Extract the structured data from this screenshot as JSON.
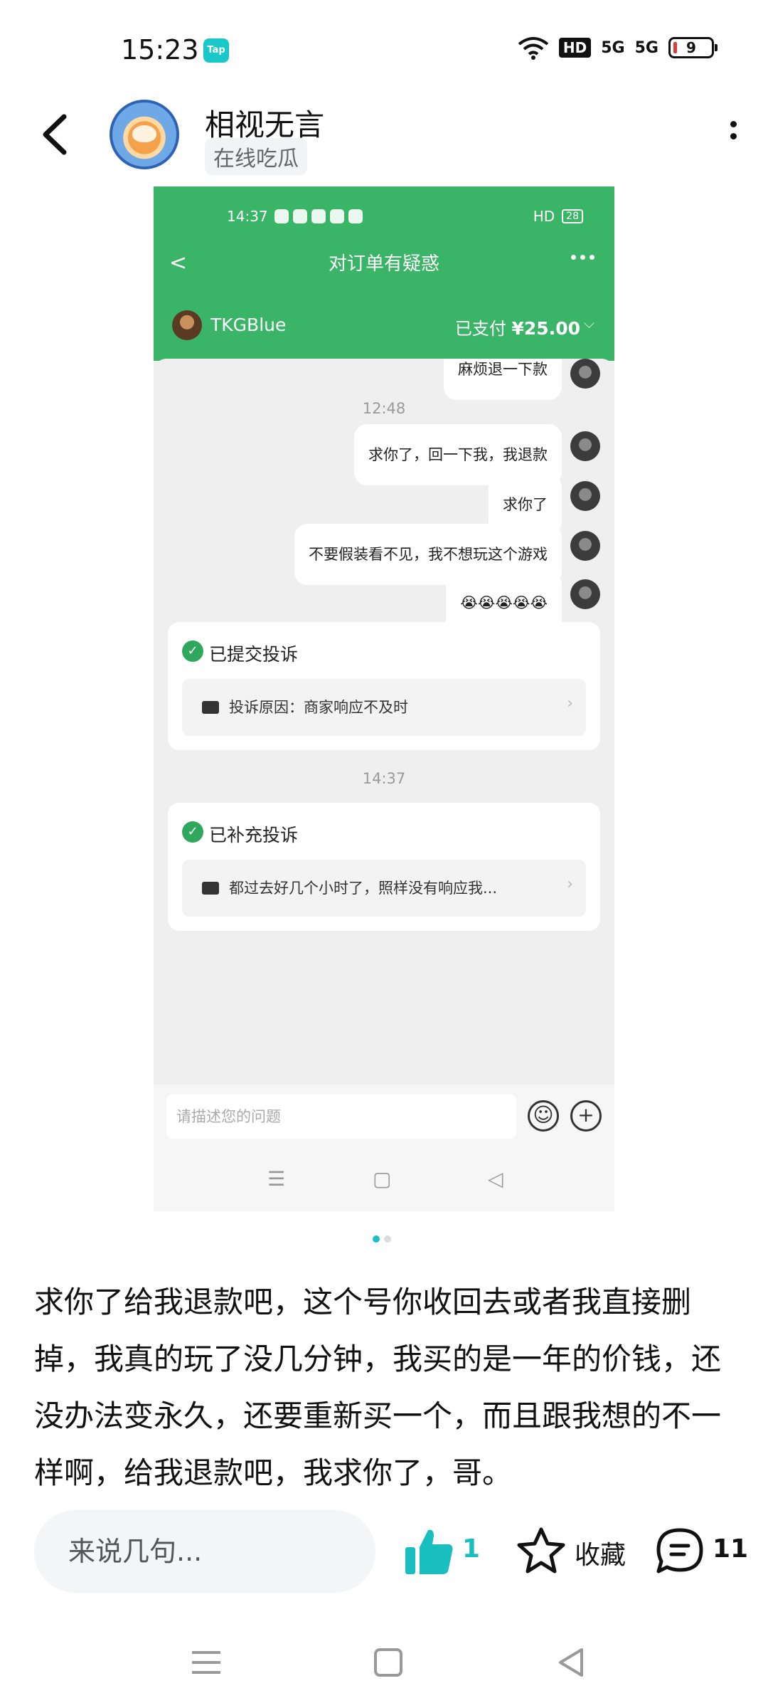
{
  "status_bar": {
    "time": "15:23",
    "app_badge": "Tap",
    "hd": "HD",
    "signal_1": "5G",
    "signal_2": "5G",
    "battery": "9"
  },
  "header": {
    "username": "相视无言",
    "tag": "在线吃瓜"
  },
  "screenshot": {
    "status_time": "14:37",
    "status_hd": "HD",
    "battery": "28",
    "title": "对订单有疑惑",
    "seller": "TKGBlue",
    "paid_label": "已支付",
    "paid_amount": "¥25.00",
    "messages": [
      {
        "text": "麻烦退一下款"
      },
      {
        "text": "求你了，回一下我，我退款"
      },
      {
        "text": "求你了"
      },
      {
        "text": "不要假装看不见，我不想玩这个游戏"
      },
      {
        "text": "😭😭😭😭😭"
      }
    ],
    "timestamps": [
      "12:48",
      "14:37"
    ],
    "cards": [
      {
        "title": "已提交投诉",
        "detail": "投诉原因：商家响应不及时"
      },
      {
        "title": "已补充投诉",
        "detail": "都过去好几个小时了，照样没有响应我..."
      }
    ],
    "input_placeholder": "请描述您的问题"
  },
  "post": {
    "text": "求你了给我退款吧，这个号你收回去或者我直接删掉，我真的玩了没几分钟，我买的是一年的价钱，还没办法变永久，还要重新买一个，而且跟我想的不一样啊，给我退款吧，我求你了，哥。"
  },
  "action_bar": {
    "comment_placeholder": "来说几句...",
    "like_count": "1",
    "favorite_label": "收藏",
    "comment_count": "11"
  },
  "colors": {
    "accent": "#19bfbf",
    "wechat_green": "#3ab466"
  },
  "carousel": {
    "page_count": 2,
    "active_page": 1
  }
}
